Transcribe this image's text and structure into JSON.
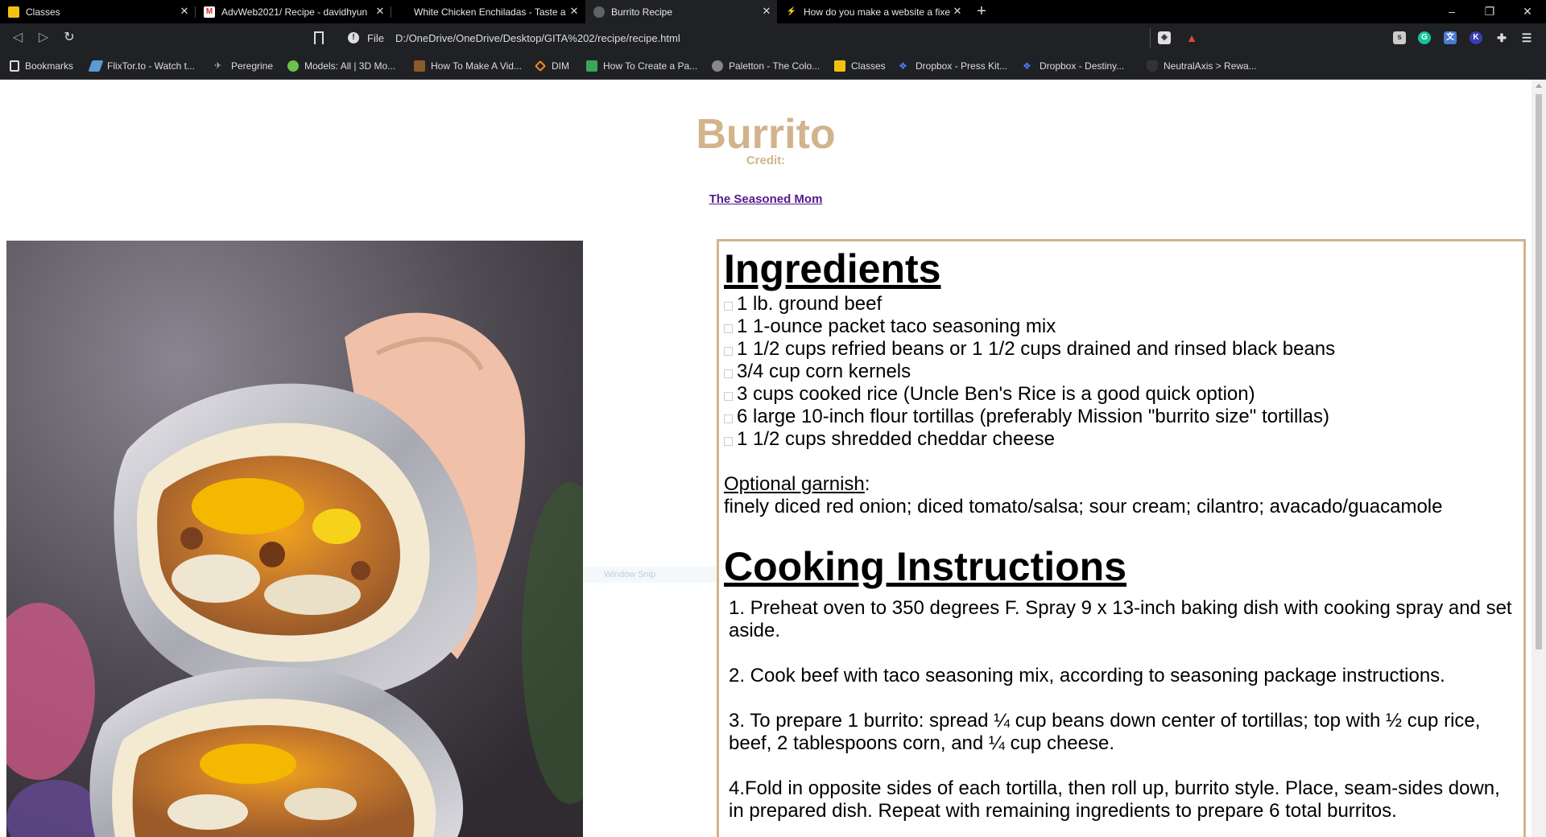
{
  "browser": {
    "tabs": [
      {
        "title": "Classes",
        "active": false
      },
      {
        "title": "AdvWeb2021/ Recipe - davidhyun",
        "active": false
      },
      {
        "title": "White Chicken Enchiladas - Taste a",
        "active": false
      },
      {
        "title": "Burrito Recipe",
        "active": true
      },
      {
        "title": "How do you make a website a fixe",
        "active": false
      }
    ],
    "new_tab_label": "+",
    "window_controls": {
      "minimize": "–",
      "restore": "❐",
      "close": "✕"
    },
    "address": {
      "protocol": "File",
      "url": "D:/OneDrive/OneDrive/Desktop/GITA%202/recipe/recipe.html"
    },
    "bookmarks": [
      "Bookmarks",
      "FlixTor.to - Watch t...",
      "Peregrine",
      "Models: All | 3D Mo...",
      "How To Make A Vid...",
      "DIM",
      "How To Create a Pa...",
      "Paletton - The Colo...",
      "Classes",
      "Dropbox - Press Kit...",
      "Dropbox - Destiny...",
      "NeutralAxis > Rewa..."
    ],
    "accent_color": "#d2b48c"
  },
  "page": {
    "title": "Burrito",
    "credit_label": "Credit:",
    "credit_link": "The Seasoned Mom",
    "overlay_label": "Window Snip",
    "ingredients_heading": "Ingredients",
    "ingredients": [
      "1 lb. ground beef",
      "1 1-ounce packet taco seasoning mix",
      "1 1/2 cups refried beans or 1 1/2 cups drained and rinsed black beans",
      "3/4 cup corn kernels",
      "3 cups cooked rice (Uncle Ben's Rice is a good quick option)",
      "6 large 10-inch flour tortillas (preferably Mission \"burrito size\" tortillas)",
      "1 1/2 cups shredded cheddar cheese"
    ],
    "garnish_label": "Optional garnish",
    "garnish_colon": ":",
    "garnish_text": "finely diced red onion; diced tomato/salsa; sour cream; cilantro; avacado/guacamole",
    "instructions_heading": "Cooking Instructions",
    "instructions": [
      "1. Preheat oven to 350 degrees F. Spray 9 x 13-inch baking dish with cooking spray and set aside.",
      "2. Cook beef with taco seasoning mix, according to seasoning package instructions.",
      "3. To prepare 1 burrito: spread ¼ cup beans down center of tortillas; top with ½ cup rice, beef, 2 tablespoons corn, and ¼ cup cheese.",
      "4.Fold in opposite sides of each tortilla, then roll up, burrito style. Place, seam-sides down, in prepared dish. Repeat with remaining ingredients to prepare 6 total burritos."
    ]
  }
}
